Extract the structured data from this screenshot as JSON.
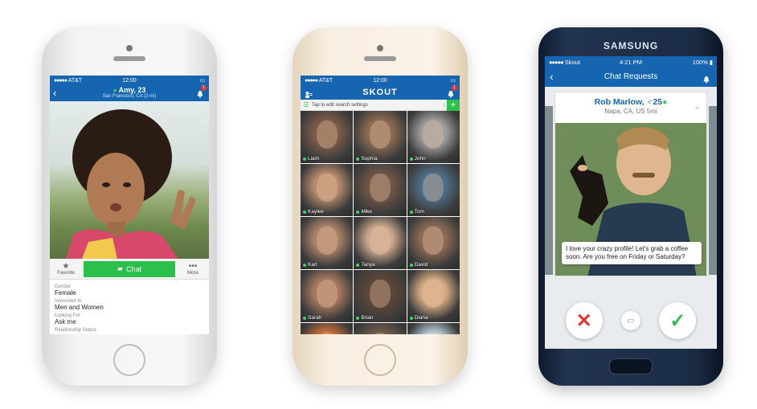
{
  "phone1": {
    "status": {
      "carrier": "AT&T",
      "time": "12:00"
    },
    "header": {
      "name": "Amy, 23",
      "location": "San Francisco, CA (3 mi)",
      "badge": "1"
    },
    "actions": {
      "favorite": "Favorite",
      "chat": "Chat",
      "more": "More"
    },
    "info": [
      {
        "label": "Gender",
        "value": "Female"
      },
      {
        "label": "Interested In",
        "value": "Men and Women"
      },
      {
        "label": "Looking For",
        "value": "Ask me"
      },
      {
        "label": "Relationship Status",
        "value": ""
      }
    ]
  },
  "phone2": {
    "status": {
      "carrier": "AT&T",
      "time": "12:00"
    },
    "header": {
      "logo": "SKOUT",
      "badge": "1"
    },
    "search": {
      "placeholder": "Tap to edit search settings"
    },
    "tiles": [
      {
        "name": "Liam",
        "color": "#7b5a48"
      },
      {
        "name": "Sophia",
        "color": "#8a6a50"
      },
      {
        "name": "John",
        "color": "#9c9c9c"
      },
      {
        "name": "Kaylee",
        "color": "#b58a6c"
      },
      {
        "name": "Mike",
        "color": "#6e5545"
      },
      {
        "name": "Tom",
        "color": "#4d6d86"
      },
      {
        "name": "Karl",
        "color": "#a98066"
      },
      {
        "name": "Tanya",
        "color": "#c9a68c"
      },
      {
        "name": "David",
        "color": "#8c6b56"
      },
      {
        "name": "Sarah",
        "color": "#a7785f"
      },
      {
        "name": "Brian",
        "color": "#5c4637"
      },
      {
        "name": "Diana",
        "color": "#d3aa82"
      },
      {
        "name": "",
        "color": "#c96f3b"
      },
      {
        "name": "",
        "color": "#70594b"
      },
      {
        "name": "",
        "color": "#b4c9d6"
      }
    ]
  },
  "phone3": {
    "brand": "SAMSUNG",
    "status": {
      "carrier": "Skout",
      "time": "4:21 PM",
      "battery": "100%"
    },
    "header": {
      "title": "Chat Requests"
    },
    "card": {
      "name": "Rob Marlow, ♂25",
      "location": "Napa, CA, US 5mi",
      "message": "I love your crazy profile! Let's grab a coffee soon. Are you free on Friday or Saturday?"
    }
  },
  "colors": {
    "brand_blue": "#1565b0",
    "green": "#2bc04c",
    "red": "#e53935"
  }
}
